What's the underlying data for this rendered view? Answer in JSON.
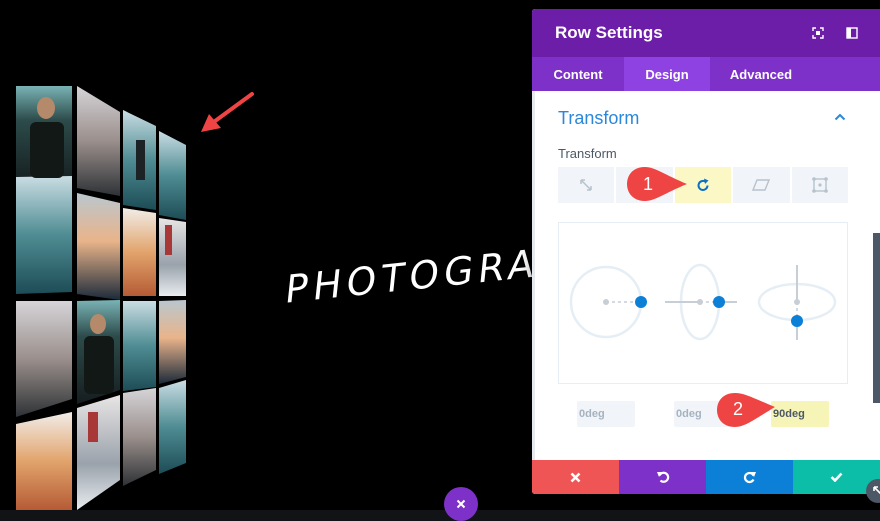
{
  "canvas": {
    "headline": "PHOTOGRA"
  },
  "panel": {
    "title": "Row Settings",
    "header_icons": [
      "fullscreen-icon",
      "sidebar-toggle-icon"
    ],
    "tabs": [
      {
        "label": "Content",
        "active": false
      },
      {
        "label": "Design",
        "active": true
      },
      {
        "label": "Advanced",
        "active": false
      }
    ],
    "section": {
      "title": "Transform",
      "expanded": true
    },
    "field_label": "Transform",
    "transform_tabs": [
      {
        "name": "scale",
        "icon": "scale-icon",
        "active": false
      },
      {
        "name": "translate",
        "icon": "translate-icon",
        "active": false
      },
      {
        "name": "rotate",
        "icon": "rotate-icon",
        "active": true
      },
      {
        "name": "skew",
        "icon": "skew-icon",
        "active": false
      },
      {
        "name": "origin",
        "icon": "origin-icon",
        "active": false
      }
    ],
    "rotate_values": [
      {
        "axis": "x",
        "value": "0deg"
      },
      {
        "axis": "y",
        "value": "0deg"
      },
      {
        "axis": "z",
        "value": "90deg"
      }
    ],
    "footer_buttons": [
      {
        "name": "discard",
        "icon": "close-icon",
        "color": "#ef5555"
      },
      {
        "name": "undo",
        "icon": "undo-icon",
        "color": "#7d31c8"
      },
      {
        "name": "redo",
        "icon": "redo-icon",
        "color": "#0c80d6"
      },
      {
        "name": "save",
        "icon": "check-icon",
        "color": "#0cbea8"
      }
    ]
  },
  "annotations": [
    {
      "number": "1"
    },
    {
      "number": "2"
    }
  ],
  "colors": {
    "header": "#6c1ea9",
    "tabs": "#7d31c8",
    "tab_active": "#8f42e2",
    "accent_blue": "#2b87da",
    "marker_red": "#ef4444",
    "highlight": "#fbf8c6"
  }
}
